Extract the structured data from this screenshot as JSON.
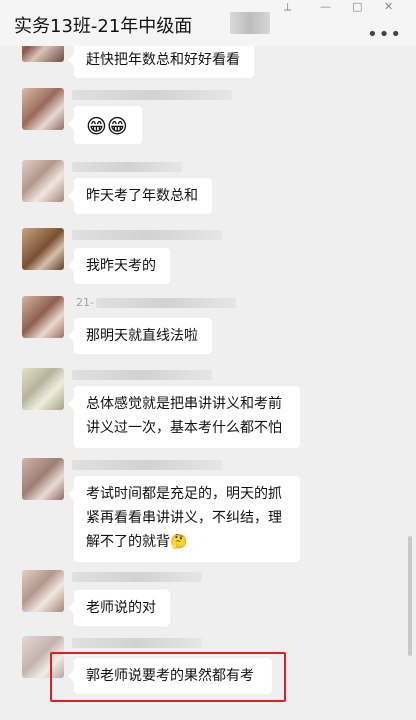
{
  "window": {
    "title": "实务13班-21年中级面",
    "controls": {
      "pin": "⟂",
      "minimize": "—",
      "maximize": "□",
      "close": "✕"
    },
    "more": "•••"
  },
  "messages": [
    {
      "text": "赶快把年数总和好好看看"
    },
    {
      "text": "😁😁"
    },
    {
      "text": "昨天考了年数总和"
    },
    {
      "text": "我昨天考的"
    },
    {
      "nick_prefix": "21-",
      "text": "那明天就直线法啦"
    },
    {
      "text": "总体感觉就是把串讲讲义和考前讲义过一次，基本考什么都不怕"
    },
    {
      "text": "考试时间都是充足的，明天的抓紧再看看串讲讲义，不纠结，理解不了的就背🤔"
    },
    {
      "text": "老师说的对"
    },
    {
      "text": "郭老师说要考的果然都有考"
    }
  ],
  "colors": {
    "highlight": "#e02020",
    "bubble": "#ffffff",
    "background": "#efefef"
  }
}
